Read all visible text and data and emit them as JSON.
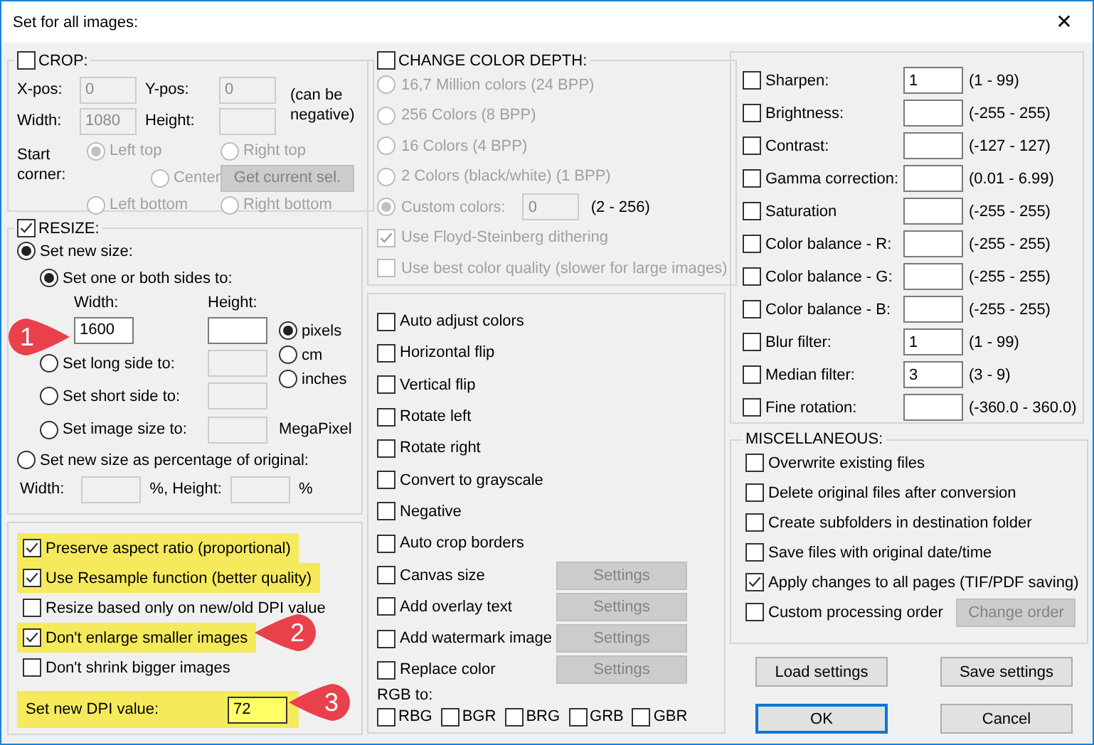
{
  "window": {
    "title": "Set for all images:",
    "close": "✕"
  },
  "crop": {
    "label": "CROP:",
    "checked": false,
    "fields": [
      {
        "label": "X-pos:",
        "value": "0"
      },
      {
        "label": "Y-pos:",
        "value": "0"
      },
      {
        "label": "Width:",
        "value": "1080"
      },
      {
        "label": "Height:"
      }
    ],
    "note": "(can be negative)",
    "corner_label": "Start corner:",
    "corners": [
      {
        "label": "Left top",
        "selected": true
      },
      {
        "label": "Right top",
        "selected": false
      },
      {
        "label": "Center",
        "selected": false
      },
      {
        "label": "Left bottom",
        "selected": false
      },
      {
        "label": "Right bottom",
        "selected": false
      }
    ],
    "button": "Get current sel."
  },
  "resize": {
    "label": "RESIZE:",
    "checked": true,
    "modes": [
      {
        "label": "Set new size:",
        "selected": true
      },
      {
        "label": "Set new size as percentage of original:",
        "selected": false
      }
    ],
    "size_options": [
      {
        "label": "Set one or both sides to:",
        "selected": true
      },
      {
        "label": "Set long side to:",
        "selected": false
      },
      {
        "label": "Set short side to:",
        "selected": false
      },
      {
        "label": "Set image size to:",
        "selected": false,
        "suffix": "MegaPixel"
      }
    ],
    "width": {
      "label": "Width:",
      "value": "1600"
    },
    "height": {
      "label": "Height:"
    },
    "units": [
      {
        "label": "pixels",
        "selected": true
      },
      {
        "label": "cm",
        "selected": false
      },
      {
        "label": "inches",
        "selected": false
      }
    ],
    "percent": {
      "width_label": "Width:",
      "width_suffix": "%, Height:",
      "height_suffix": "%"
    }
  },
  "options": [
    {
      "label": "Preserve aspect ratio (proportional)",
      "checked": true,
      "highlighted": true
    },
    {
      "label": "Use Resample function (better quality)",
      "checked": true,
      "highlighted": true
    },
    {
      "label": "Resize based only on new/old DPI value",
      "checked": false,
      "highlighted": false
    },
    {
      "label": "Don't enlarge smaller images",
      "checked": true,
      "highlighted": true
    },
    {
      "label": "Don't shrink bigger images",
      "checked": false,
      "highlighted": false
    }
  ],
  "dpi": {
    "label": "Set new DPI value:",
    "value": "72",
    "highlighted": true
  },
  "callouts": [
    "1",
    "2",
    "3"
  ],
  "color_depth": {
    "label": "CHANGE COLOR DEPTH:",
    "checked": false,
    "options": [
      {
        "label": "16,7 Million colors (24 BPP)",
        "selected": false
      },
      {
        "label": "256 Colors (8 BPP)",
        "selected": false
      },
      {
        "label": "16 Colors (4 BPP)",
        "selected": false
      },
      {
        "label": "2 Colors (black/white) (1 BPP)",
        "selected": false
      },
      {
        "label": "Custom colors:",
        "selected": true,
        "value": "0",
        "range": "(2 - 256)"
      }
    ],
    "dithering": [
      {
        "label": "Use Floyd-Steinberg dithering",
        "checked": true
      },
      {
        "label": "Use best color quality (slower for large images)",
        "checked": false
      }
    ]
  },
  "operations": [
    {
      "label": "Auto adjust colors",
      "checked": false
    },
    {
      "label": "Horizontal flip",
      "checked": false
    },
    {
      "label": "Vertical flip",
      "checked": false
    },
    {
      "label": "Rotate left",
      "checked": false
    },
    {
      "label": "Rotate right",
      "checked": false
    },
    {
      "label": "Convert to grayscale",
      "checked": false
    },
    {
      "label": "Negative",
      "checked": false
    },
    {
      "label": "Auto crop borders",
      "checked": false
    },
    {
      "label": "Canvas size",
      "checked": false,
      "button": "Settings"
    },
    {
      "label": "Add overlay text",
      "checked": false,
      "button": "Settings"
    },
    {
      "label": "Add watermark image",
      "checked": false,
      "button": "Settings"
    },
    {
      "label": "Replace color",
      "checked": false,
      "button": "Settings"
    }
  ],
  "rgb": {
    "label": "RGB to:",
    "options": [
      {
        "label": "RBG",
        "checked": false
      },
      {
        "label": "BGR",
        "checked": false
      },
      {
        "label": "BRG",
        "checked": false
      },
      {
        "label": "GRB",
        "checked": false
      },
      {
        "label": "GBR",
        "checked": false
      }
    ]
  },
  "adjustments": [
    {
      "label": "Sharpen:",
      "checked": false,
      "value": "1",
      "range": "(1 - 99)"
    },
    {
      "label": "Brightness:",
      "checked": false,
      "range": "(-255 - 255)"
    },
    {
      "label": "Contrast:",
      "checked": false,
      "range": "(-127 - 127)"
    },
    {
      "label": "Gamma correction:",
      "checked": false,
      "range": "(0.01 - 6.99)"
    },
    {
      "label": "Saturation",
      "checked": false,
      "range": "(-255 - 255)"
    },
    {
      "label": "Color balance - R:",
      "checked": false,
      "range": "(-255 - 255)"
    },
    {
      "label": "Color balance - G:",
      "checked": false,
      "range": "(-255 - 255)"
    },
    {
      "label": "Color balance - B:",
      "checked": false,
      "range": "(-255 - 255)"
    },
    {
      "label": "Blur filter:",
      "checked": false,
      "value": "1",
      "range": "(1 - 99)"
    },
    {
      "label": "Median filter:",
      "checked": false,
      "value": "3",
      "range": "(3 - 9)"
    },
    {
      "label": "Fine rotation:",
      "checked": false,
      "range": "(-360.0 - 360.0)"
    }
  ],
  "misc": {
    "label": "MISCELLANEOUS:",
    "items": [
      {
        "label": "Overwrite existing files",
        "checked": false
      },
      {
        "label": "Delete original files after conversion",
        "checked": false
      },
      {
        "label": "Create subfolders in destination folder",
        "checked": false
      },
      {
        "label": "Save files with original date/time",
        "checked": false
      },
      {
        "label": "Apply changes to all pages (TIF/PDF saving)",
        "checked": true
      },
      {
        "label": "Custom processing order",
        "checked": false,
        "button": "Change order"
      }
    ]
  },
  "buttons": [
    {
      "label": "Load settings",
      "default": false
    },
    {
      "label": "Save settings",
      "default": false
    },
    {
      "label": "OK",
      "default": true
    },
    {
      "label": "Cancel",
      "default": false
    }
  ]
}
